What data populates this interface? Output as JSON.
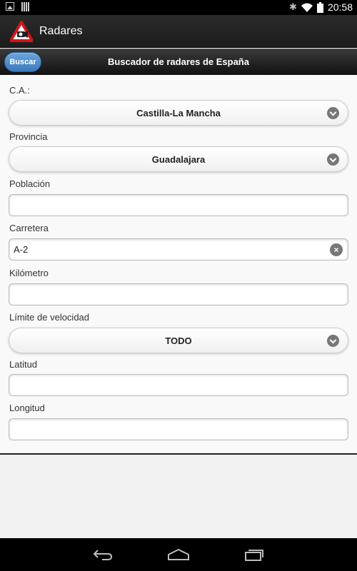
{
  "status_bar": {
    "time": "20:58",
    "left_icons": [
      "image-icon",
      "signal-bars-icon"
    ],
    "right_icons": [
      "bluetooth-icon",
      "wifi-icon",
      "battery-icon"
    ]
  },
  "action_bar": {
    "title": "Radares",
    "icon": "radar-warning-icon"
  },
  "header": {
    "button_label": "Buscar",
    "title": "Buscador de radares de España",
    "button_color": "#4a8cd0"
  },
  "form": {
    "ca": {
      "label": "C.A.:",
      "value": "Castilla-La Mancha"
    },
    "provincia": {
      "label": "Provincia",
      "value": "Guadalajara"
    },
    "poblacion": {
      "label": "Población",
      "value": ""
    },
    "carretera": {
      "label": "Carretera",
      "value": "A-2"
    },
    "kilometro": {
      "label": "Kilómetro",
      "value": ""
    },
    "limite": {
      "label": "Límite de velocidad",
      "value": "TODO"
    },
    "latitud": {
      "label": "Latitud",
      "value": ""
    },
    "longitud": {
      "label": "Longitud",
      "value": ""
    }
  },
  "nav_bar": {
    "icons": [
      "back-icon",
      "home-icon",
      "recent-apps-icon"
    ]
  }
}
